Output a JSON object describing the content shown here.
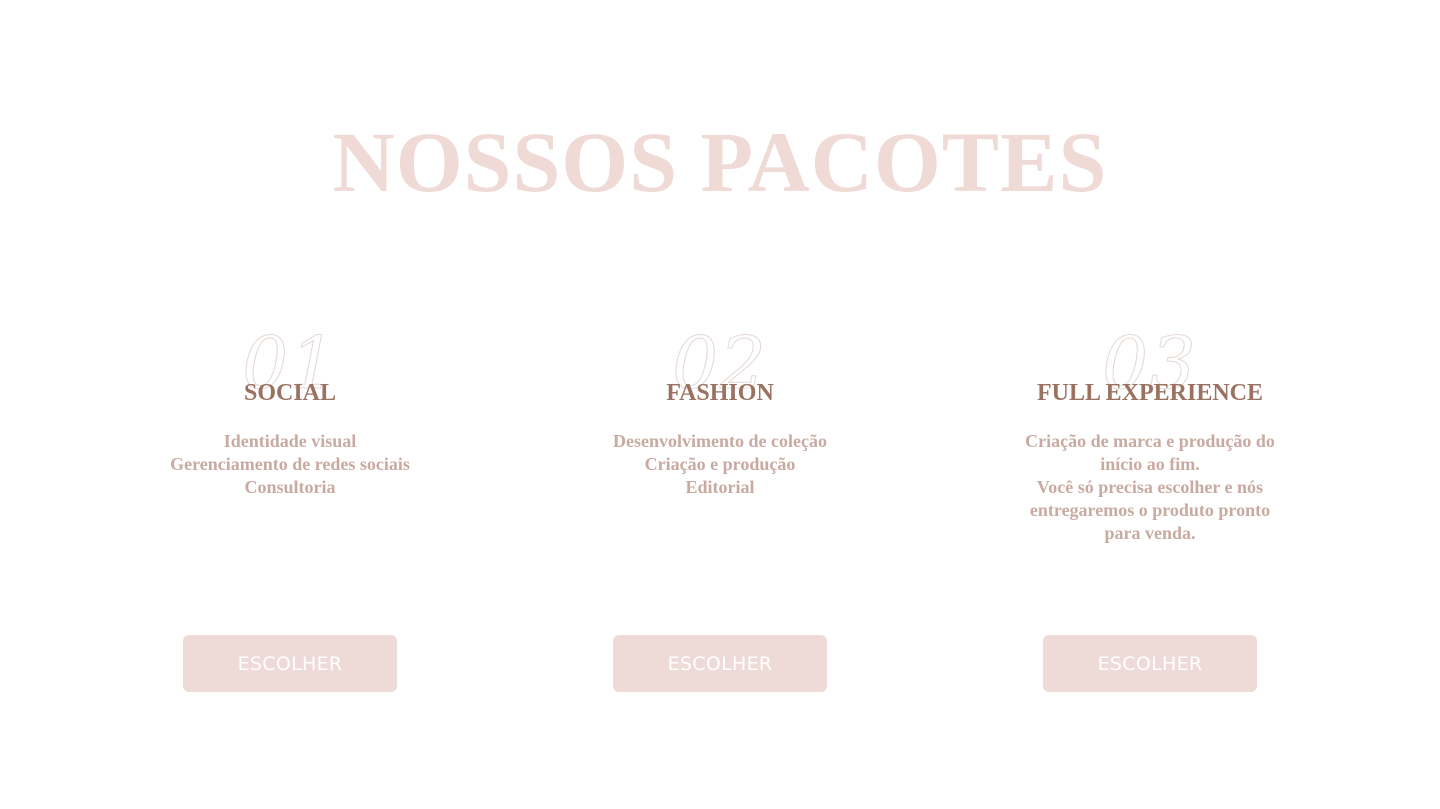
{
  "title": "NOSSOS PACOTES",
  "packages": [
    {
      "number": "01",
      "name": "SOCIAL",
      "lines": [
        "Identidade visual",
        "Gerenciamento de redes sociais",
        "Consultoria"
      ],
      "button_label": "ESCOLHER"
    },
    {
      "number": "02",
      "name": "FASHION",
      "lines": [
        "Desenvolvimento de coleção",
        "Criação e produção",
        "Editorial"
      ],
      "button_label": "ESCOLHER"
    },
    {
      "number": "03",
      "name": "FULL EXPERIENCE",
      "lines": [
        "Criação de marca e produção do",
        "início ao fim.",
        "Você só precisa escolher e nós",
        "entregaremos o produto pronto",
        "para venda."
      ],
      "button_label": "ESCOLHER"
    }
  ],
  "colors": {
    "title": "#efdad6",
    "package_name": "#9b7262",
    "package_text": "#c9aaa1",
    "button_bg": "#eedad7",
    "button_text": "#ffffff"
  }
}
